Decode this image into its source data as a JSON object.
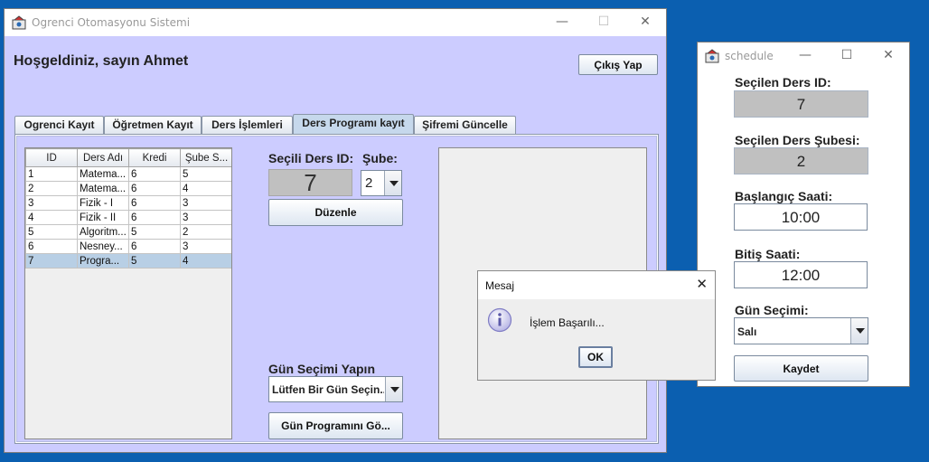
{
  "main_window": {
    "title": "Ogrenci Otomasyonu Sistemi",
    "welcome": "Hoşgeldiniz, sayın Ahmet",
    "logout_label": "Çıkış Yap",
    "tabs": [
      "Ogrenci Kayıt",
      "Öğretmen Kayıt",
      "Ders İşlemleri",
      "Ders Programı kayıt",
      "Şifremi Güncelle"
    ],
    "active_tab": "Ders Programı kayıt",
    "table": {
      "columns": [
        "ID",
        "Ders Adı",
        "Kredi",
        "Şube S..."
      ],
      "rows": [
        [
          "1",
          "Matema...",
          "6",
          "5"
        ],
        [
          "2",
          "Matema...",
          "6",
          "4"
        ],
        [
          "3",
          "Fizik - I",
          "6",
          "3"
        ],
        [
          "4",
          "Fizik - II",
          "6",
          "3"
        ],
        [
          "5",
          "Algoritm...",
          "5",
          "2"
        ],
        [
          "6",
          "Nesney...",
          "6",
          "3"
        ],
        [
          "7",
          "Progra...",
          "5",
          "4"
        ]
      ],
      "selected_row": 7
    },
    "selected_course_label": "Seçili Ders ID:",
    "selected_course_value": "7",
    "branch_label": "Şube:",
    "branch_value": "2",
    "edit_label": "Düzenle",
    "day_select_label": "Gün Seçimi Yapın",
    "day_select_value": "Lütfen Bir Gün Seçin...",
    "show_schedule_label": "Gün Programını Gö..."
  },
  "dialog": {
    "title": "Mesaj",
    "message": "İşlem Başarılı...",
    "ok_label": "OK"
  },
  "schedule_window": {
    "title": "schedule",
    "course_id_label": "Seçilen Ders ID:",
    "course_id_value": "7",
    "branch_label": "Seçilen Ders Şubesi:",
    "branch_value": "2",
    "start_label": "Başlangıç Saati:",
    "start_value": "10:00",
    "end_label": "Bitiş Saati:",
    "end_value": "12:00",
    "day_label": "Gün Seçimi:",
    "day_value": "Salı",
    "save_label": "Kaydet"
  },
  "colors": {
    "desktop": "#0b5fb0",
    "panel": "#ccccff",
    "selection": "#b8cfe5",
    "readonly_field": "#c0c0c0"
  }
}
